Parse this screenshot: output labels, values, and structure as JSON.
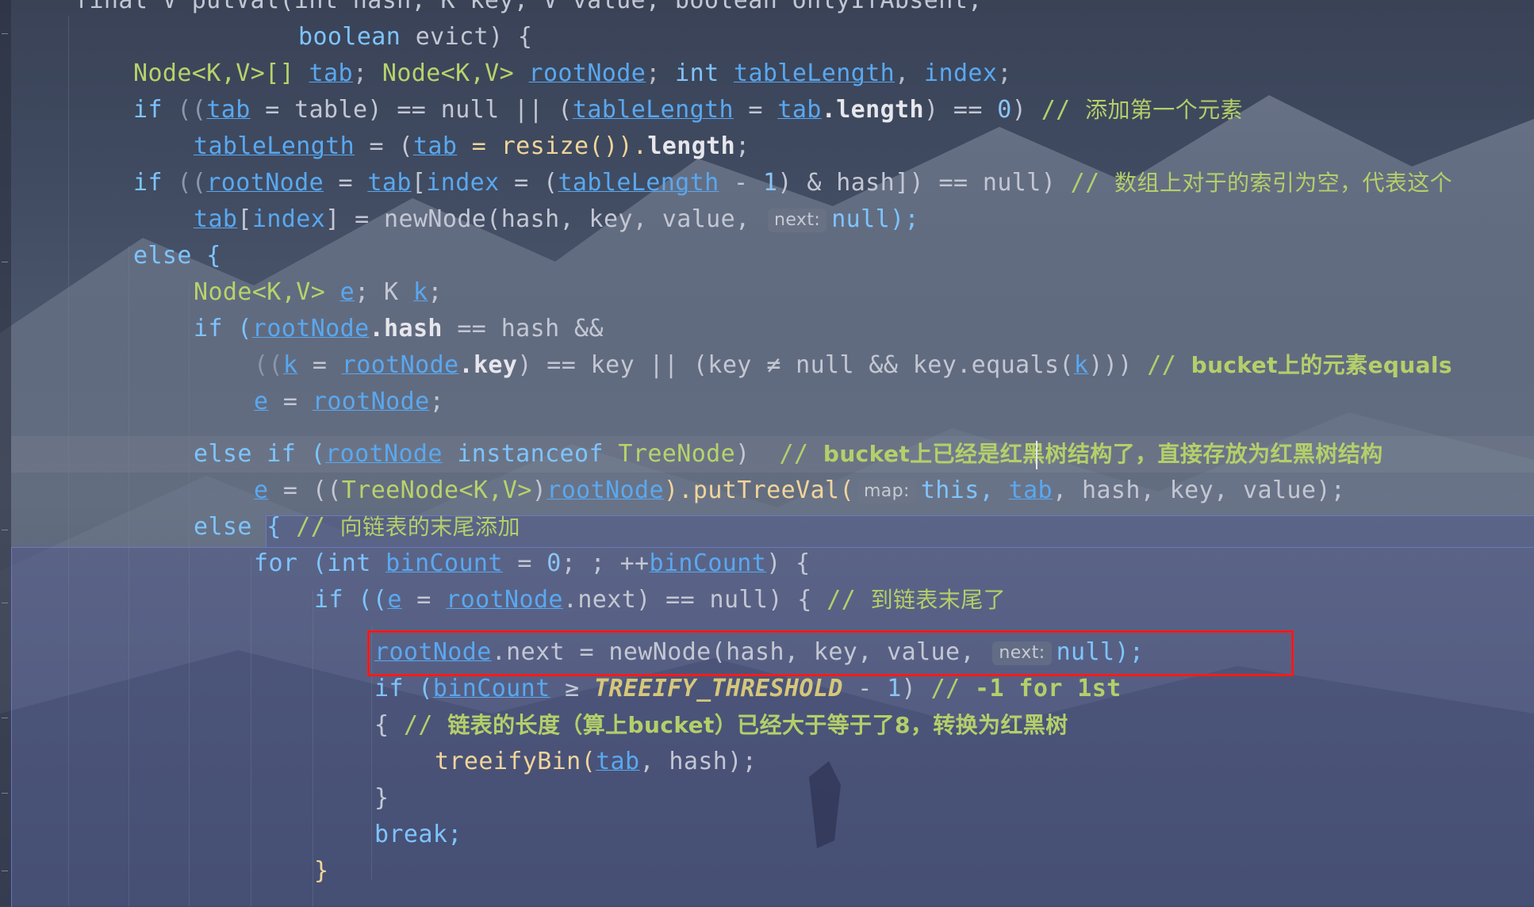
{
  "editor": {
    "language": "java",
    "method_header_line": "final V putVal(int hash, K key, V value, boolean onlyIfAbsent,",
    "colors": {
      "keyword": "#7ec4ff",
      "type": "#b7d36b",
      "field": "#59a8f0",
      "method": "#f0d59a",
      "comment": "#b4cf6a",
      "highlight_box": "#ff1a1a"
    }
  },
  "lines": [
    {
      "segments": [
        "final V putVal(int hash, K key, V value, boolean onlyIfAbsent,"
      ]
    },
    {
      "segments": [
        "boolean",
        "evict) {"
      ]
    },
    {
      "segments": [
        "Node<K,V>[]",
        "tab",
        "; ",
        "Node<K,V>",
        "rootNode",
        "; ",
        "int",
        "tableLength",
        ", ",
        "index",
        ";"
      ]
    },
    {
      "segments": [
        "if",
        "((",
        "tab",
        " = table) == null || (",
        "tableLength",
        " = ",
        "tab",
        ".length",
        ") == ",
        "0",
        ") ",
        "//",
        "添加第一个元素"
      ]
    },
    {
      "segments": [
        "tableLength",
        " = (",
        "tab",
        " = resize()).",
        "length",
        ";"
      ]
    },
    {
      "segments": [
        "if",
        "((",
        "rootNode",
        " = ",
        "tab",
        "[",
        "index",
        " = (",
        "tableLength",
        " - ",
        "1",
        ") & hash]) == null) ",
        "//",
        "数组上对于的索引为空，代表这个"
      ]
    },
    {
      "segments": [
        "tab",
        "[",
        "index",
        "] = newNode(hash, key, value, ",
        "next:",
        "null);"
      ]
    },
    {
      "segments": [
        "else {"
      ]
    },
    {
      "segments": [
        "Node<K,V>",
        "e",
        "; K ",
        "k",
        ";"
      ]
    },
    {
      "segments": [
        "if (",
        "rootNode",
        ".hash",
        " == hash &&"
      ]
    },
    {
      "segments": [
        "((",
        "k",
        " = ",
        "rootNode",
        ".key",
        ") == key || (key ≠ null && key.equals(",
        "k",
        "))) ",
        "//",
        "bucket上的元素equals"
      ]
    },
    {
      "segments": [
        "e",
        " = ",
        "rootNode",
        ";"
      ]
    },
    {
      "segments": [
        "else if (",
        "rootNode",
        " instanceof ",
        "TreeNode",
        ")  ",
        "//",
        "bucket上已经是红黑树结构了，直接存放为红黑树结构"
      ]
    },
    {
      "segments": [
        "e",
        " = ((",
        "TreeNode<K,V>",
        ")",
        "rootNode",
        ").putTreeVal(",
        "map:",
        "this, ",
        "tab",
        ", hash, key, value);"
      ]
    },
    {
      "segments": [
        "else { ",
        "//",
        "向链表的末尾添加"
      ]
    },
    {
      "segments": [
        "for (int ",
        "binCount",
        " = ",
        "0",
        "; ; ++",
        "binCount",
        ") {"
      ]
    },
    {
      "segments": [
        "if ((",
        "e",
        " = ",
        "rootNode",
        ".next) == null) { ",
        "//",
        "到链表末尾了"
      ]
    },
    {
      "segments": [
        "rootNode",
        ".next = newNode(hash, key, value, ",
        "next:",
        "null);"
      ]
    },
    {
      "segments": [
        "if (",
        "binCount",
        " ≥ ",
        "TREEIFY_THRESHOLD",
        " - ",
        "1",
        ") ",
        "//",
        " -1 for 1st"
      ]
    },
    {
      "segments": [
        "{ ",
        "//",
        "链表的长度（算上bucket）已经大于等于了8，转换为红黑树"
      ]
    },
    {
      "segments": [
        "treeifyBin(",
        "tab",
        ", hash);"
      ]
    },
    {
      "segments": [
        "}"
      ]
    },
    {
      "segments": [
        "break;"
      ]
    },
    {
      "segments": [
        "}"
      ]
    }
  ]
}
